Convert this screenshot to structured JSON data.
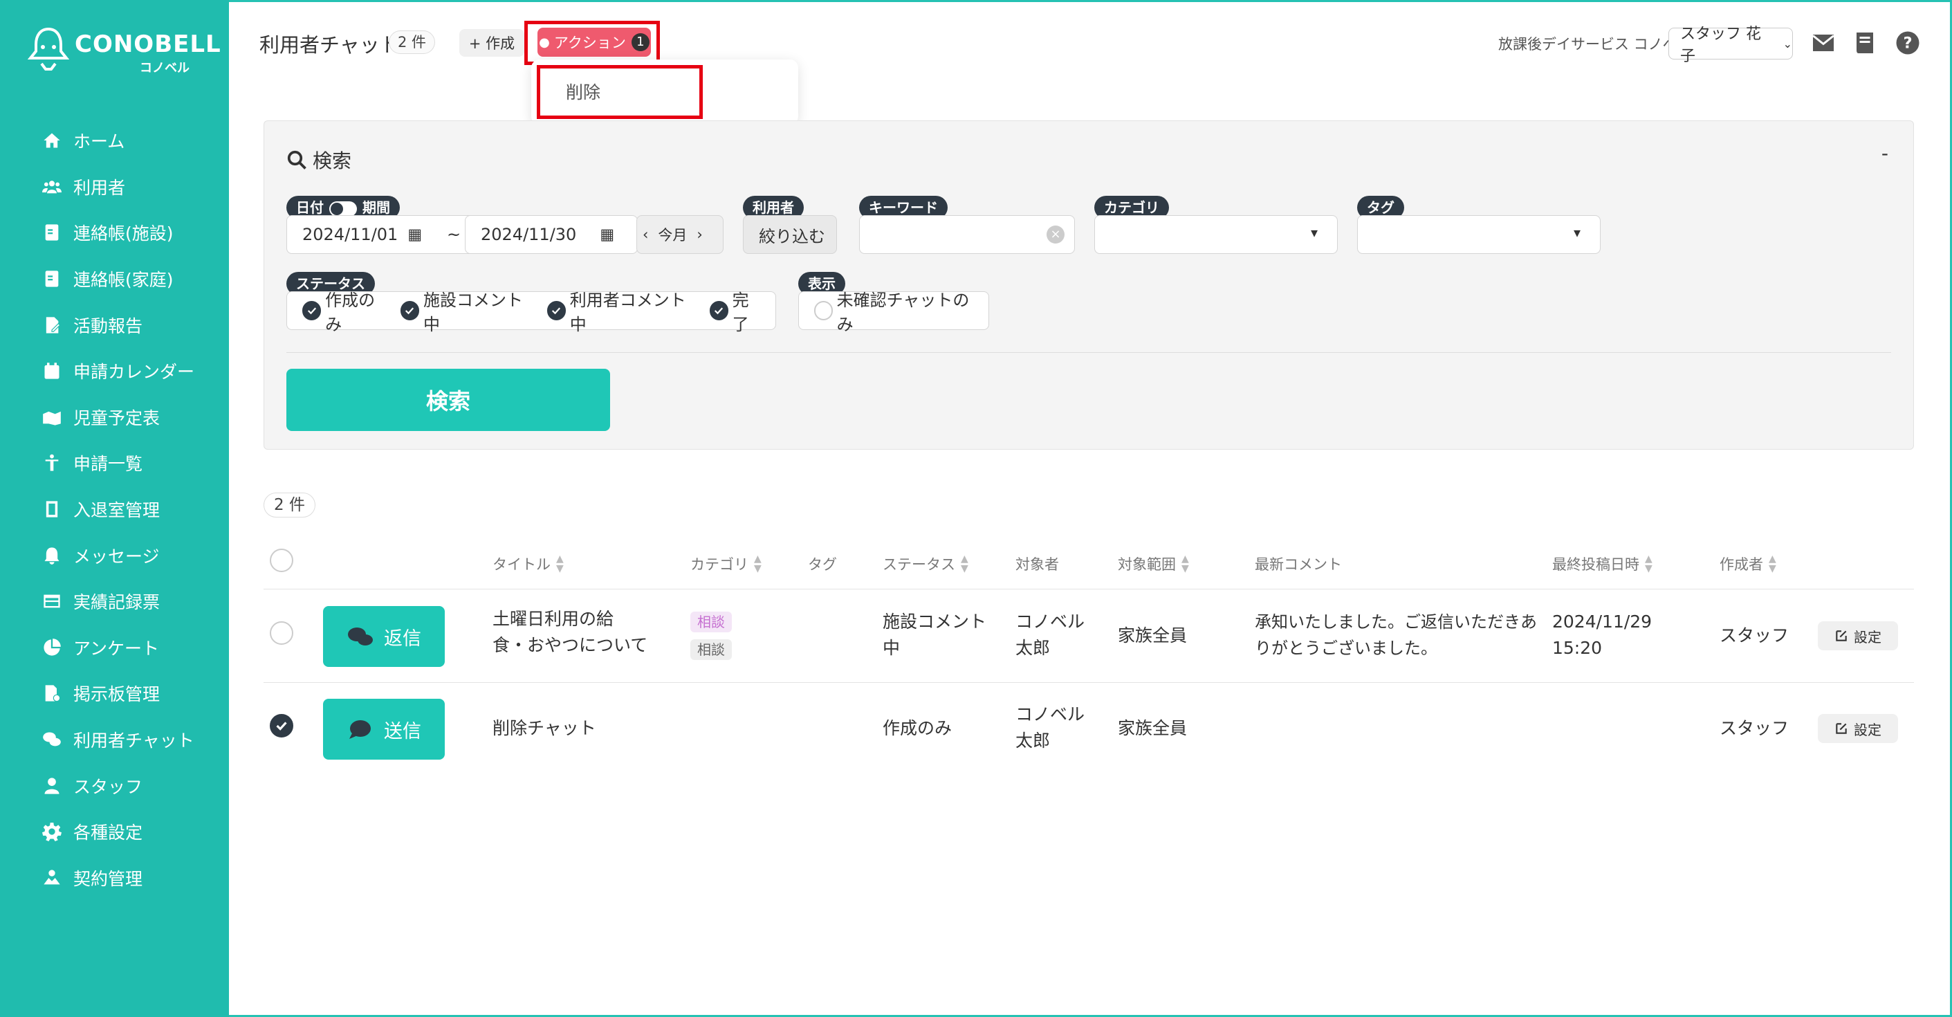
{
  "brand": {
    "name": "CONOBELL",
    "sub": "コノベル"
  },
  "sidebar": {
    "items": [
      {
        "label": "ホーム",
        "icon": "home-icon"
      },
      {
        "label": "利用者",
        "icon": "users-icon"
      },
      {
        "label": "連絡帳(施設)",
        "icon": "contact-book-icon"
      },
      {
        "label": "連絡帳(家庭)",
        "icon": "contact-book-icon"
      },
      {
        "label": "活動報告",
        "icon": "report-icon"
      },
      {
        "label": "申請カレンダー",
        "icon": "calendar-icon"
      },
      {
        "label": "児童予定表",
        "icon": "schedule-icon"
      },
      {
        "label": "申請一覧",
        "icon": "request-list-icon"
      },
      {
        "label": "入退室管理",
        "icon": "entry-exit-icon"
      },
      {
        "label": "メッセージ",
        "icon": "bell-icon"
      },
      {
        "label": "実績記録票",
        "icon": "record-icon"
      },
      {
        "label": "アンケート",
        "icon": "survey-icon"
      },
      {
        "label": "掲示板管理",
        "icon": "board-icon"
      },
      {
        "label": "利用者チャット",
        "icon": "chat-icon"
      },
      {
        "label": "スタッフ",
        "icon": "staff-icon"
      },
      {
        "label": "各種設定",
        "icon": "gear-icon"
      },
      {
        "label": "契約管理",
        "icon": "contract-icon"
      }
    ]
  },
  "header": {
    "title": "利用者チャット",
    "count": "2 件",
    "create_label": "+ 作成",
    "action_label": "アクション",
    "action_badge": "1",
    "dropdown_delete": "削除",
    "facility": "放課後デイサービス コノベル",
    "staff": "スタッフ 花子"
  },
  "search": {
    "title": "検索",
    "collapse": "-",
    "date_label_a": "日付",
    "date_label_b": "期間",
    "date_from": "2024/11/01",
    "tilde": "~",
    "date_to": "2024/11/30",
    "this_month": "今月",
    "user_label": "利用者",
    "user_filter": "絞り込む",
    "keyword_label": "キーワード",
    "category_label": "カテゴリ",
    "tag_label": "タグ",
    "status_label": "ステータス",
    "status_options": [
      "作成のみ",
      "施設コメント中",
      "利用者コメント中",
      "完了"
    ],
    "display_label": "表示",
    "display_option": "未確認チャットのみ",
    "button": "検索"
  },
  "results": {
    "count": "2 件",
    "headers": [
      "タイトル",
      "カテゴリ",
      "タグ",
      "ステータス",
      "対象者",
      "対象範囲",
      "最新コメント",
      "最終投稿日時",
      "作成者"
    ],
    "rows": [
      {
        "action": "返信",
        "title_l1": "土曜日利用の給",
        "title_l2": "食・おやつについて",
        "cat1": "相談",
        "cat2": "相談",
        "status_l1": "施設コメント",
        "status_l2": "中",
        "target_l1": "コノベル",
        "target_l2": "太郎",
        "scope": "家族全員",
        "comment_l1": "承知いたしました。ご返信いただきあ",
        "comment_l2": "りがとうございました。",
        "date_l1": "2024/11/29",
        "date_l2": "15:20",
        "author": "スタッフ",
        "setting": "設定",
        "checked": false
      },
      {
        "action": "送信",
        "title_l1": "削除チャット",
        "status_l1": "作成のみ",
        "target_l1": "コノベル",
        "target_l2": "太郎",
        "scope": "家族全員",
        "author": "スタッフ",
        "setting": "設定",
        "checked": true
      }
    ]
  },
  "colors": {
    "sidebar": "#20bcae",
    "accent": "#1fc7b6",
    "action": "#ef5a6e",
    "highlight": "#e60012",
    "label_dark": "#2f3a45"
  }
}
